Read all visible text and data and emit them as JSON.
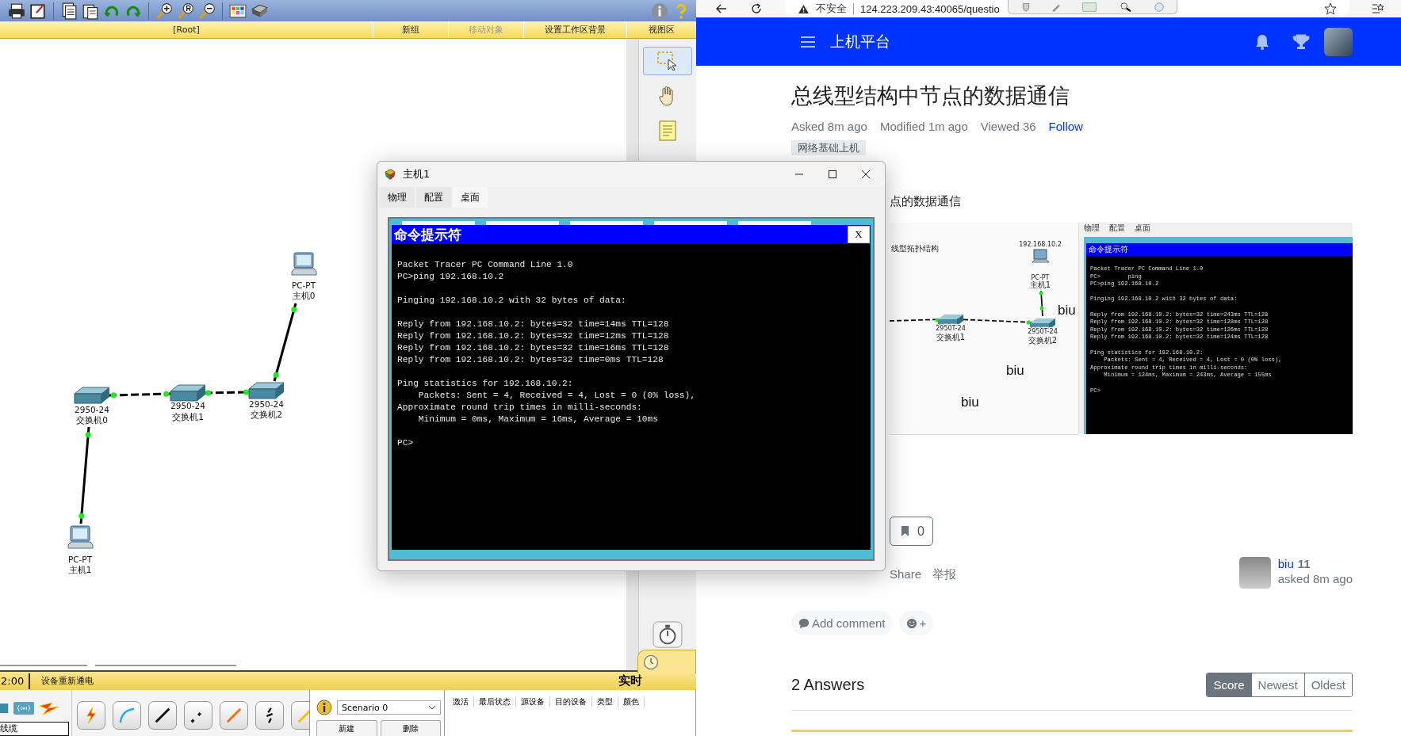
{
  "packet_tracer": {
    "breadcrumb": "[Root]",
    "nav_actions": [
      {
        "label": "新组",
        "disabled": false
      },
      {
        "label": "移动对象",
        "disabled": true
      },
      {
        "label": "设置工作区背景",
        "disabled": false
      },
      {
        "label": "视图区",
        "disabled": false
      }
    ],
    "devices": [
      {
        "kind": "pc",
        "model": "PC-PT",
        "name": "主机0"
      },
      {
        "kind": "switch",
        "model": "2950-24",
        "name": "交换机0"
      },
      {
        "kind": "switch",
        "model": "2950-24",
        "name": "交换机1"
      },
      {
        "kind": "switch",
        "model": "2950-24",
        "name": "交换机2"
      },
      {
        "kind": "pc",
        "model": "PC-PT",
        "name": "主机1"
      }
    ],
    "tools": [
      {
        "kind": "select",
        "selected": true
      },
      {
        "kind": "hand",
        "selected": false
      },
      {
        "kind": "note",
        "selected": false
      }
    ],
    "clock": "2:00",
    "status": "设备重新通电",
    "mode": "实时",
    "device_category": "线缆",
    "scenario": "Scenario 0",
    "scenario_buttons": [
      "新建",
      "删除"
    ],
    "pdu_columns": [
      "激活",
      "最后状态",
      "源设备",
      "目的设备",
      "类型",
      "颜色"
    ]
  },
  "browser": {
    "security": "不安全",
    "url": "124.223.209.43:40065/questio",
    "site_title": "上机平台",
    "question": {
      "title": "总线型结构中节点的数据通信",
      "meta": [
        "Asked 8m ago",
        "Modified 1m ago",
        "Viewed 36"
      ],
      "follow": "Follow",
      "tag": "网络基础上机",
      "body": "点的数据通信",
      "screenshot": {
        "topology_caption": "线型拓扑结构",
        "ip_label": "192.168.10.2",
        "devices": [
          {
            "kind": "pc",
            "model": "PC-PT",
            "name": "主机1"
          },
          {
            "kind": "switch",
            "model": "2950T-24",
            "name": "交换机1"
          },
          {
            "kind": "switch",
            "model": "2950T-24",
            "name": "交换机2"
          }
        ],
        "notes": [
          "biu",
          "biu",
          "biu"
        ],
        "tabs": [
          "物理",
          "配置",
          "桌面"
        ],
        "prompt_title": "命令提示符",
        "console": [
          [
            "Packet Tracer PC Command Line 1.0",
            "PC>        ping",
            "PC>ping 192.168.10.2"
          ],
          [
            "Pinging 192.168.10.2 with 32 bytes of data:"
          ],
          [
            "Reply from 192.168.10.2: bytes=32 time=243ms TTL=128",
            "Reply from 192.168.10.2: bytes=32 time=128ms TTL=128",
            "Reply from 192.168.10.2: bytes=32 time=126ms TTL=128",
            "Reply from 192.168.10.2: bytes=32 time=124ms TTL=128"
          ],
          [
            "Ping statistics for 192.168.10.2:",
            "    Packets: Sent = 4, Received = 4, Lost = 0 (0% loss),",
            "Approximate round trip times in milli-seconds:",
            "    Minimum = 124ms, Maximum = 243ms, Average = 155ms"
          ],
          [
            "PC>"
          ]
        ]
      },
      "bookmarks": "0",
      "actions": [
        "Share",
        "举报"
      ],
      "author": {
        "name": "biu",
        "reputation": "11",
        "time": "asked 8m ago"
      },
      "add_comment": "Add comment",
      "reaction": "+"
    },
    "answers": {
      "title": "2 Answers",
      "sort": [
        {
          "label": "Score",
          "selected": true
        },
        {
          "label": "Newest",
          "selected": false
        },
        {
          "label": "Oldest",
          "selected": false
        }
      ]
    }
  },
  "dialog": {
    "title": "主机1",
    "tabs": [
      {
        "label": "物理",
        "selected": false
      },
      {
        "label": "配置",
        "selected": false
      },
      {
        "label": "桌面",
        "selected": true
      }
    ],
    "prompt_title": "命令提示符",
    "prompt_close": "X",
    "console": [
      [
        "Packet Tracer PC Command Line 1.0",
        "PC>ping 192.168.10.2"
      ],
      [
        "Pinging 192.168.10.2 with 32 bytes of data:"
      ],
      [
        "Reply from 192.168.10.2: bytes=32 time=14ms TTL=128",
        "Reply from 192.168.10.2: bytes=32 time=12ms TTL=128",
        "Reply from 192.168.10.2: bytes=32 time=16ms TTL=128",
        "Reply from 192.168.10.2: bytes=32 time=0ms TTL=128"
      ],
      [
        "Ping statistics for 192.168.10.2:",
        "    Packets: Sent = 4, Received = 4, Lost = 0 (0% loss),",
        "Approximate round trip times in milli-seconds:",
        "    Minimum = 0ms, Maximum = 16ms, Average = 10ms"
      ],
      [
        "PC>"
      ]
    ]
  }
}
